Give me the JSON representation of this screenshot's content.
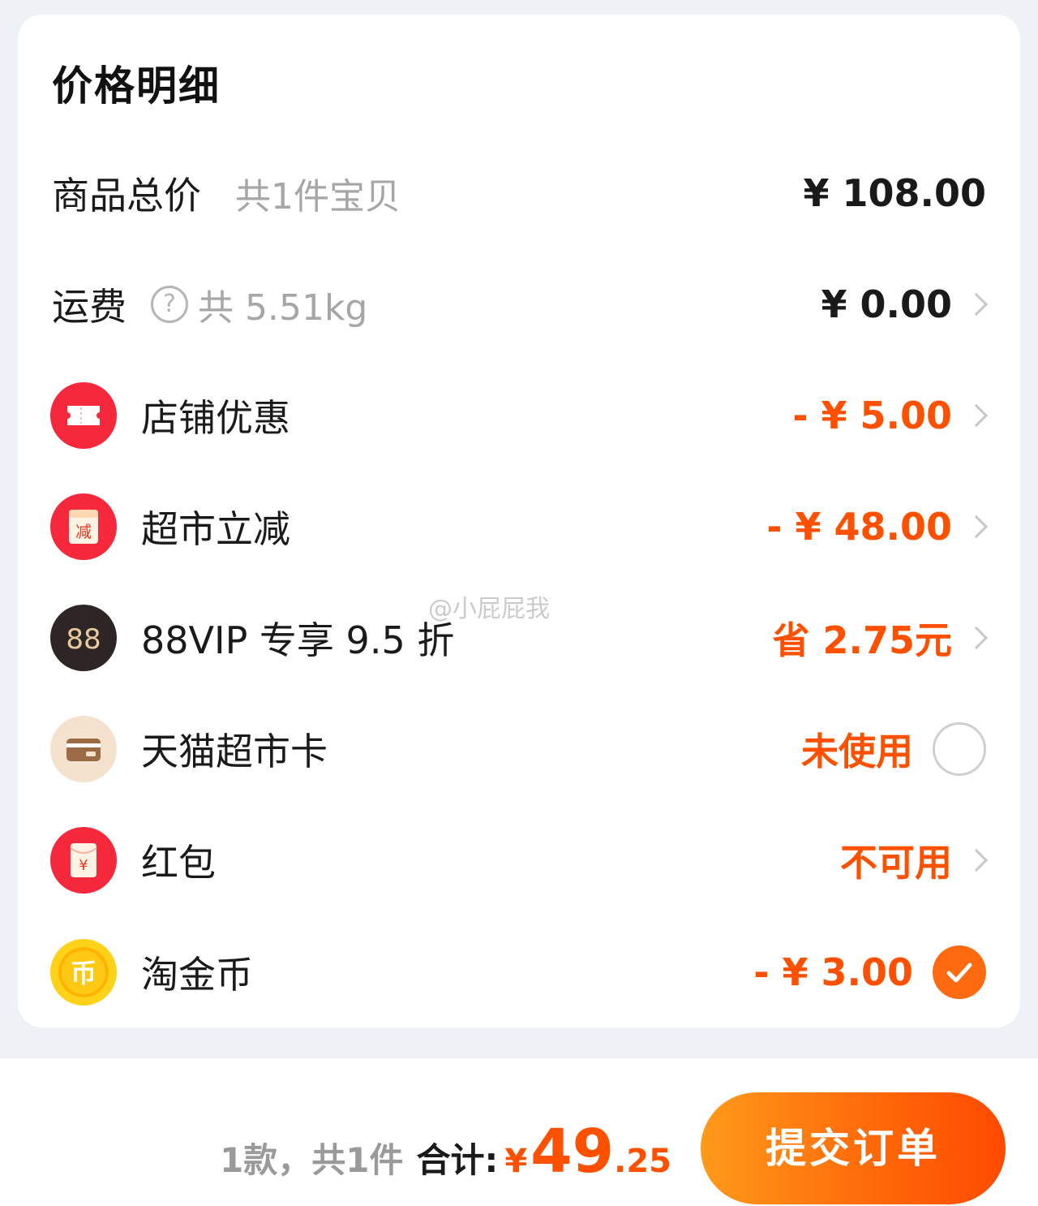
{
  "card": {
    "title": "价格明细"
  },
  "rows": {
    "goods_total": {
      "label": "商品总价",
      "sub": "共1件宝贝",
      "value": "¥ 108.00"
    },
    "shipping": {
      "label": "运费",
      "help_glyph": "?",
      "sub": "共 5.51kg",
      "value": "¥ 0.00"
    },
    "store_discount": {
      "label": "店铺优惠",
      "value": "- ¥ 5.00",
      "icon": "ticket-icon"
    },
    "supermarket_off": {
      "label": "超市立减",
      "value": "- ¥ 48.00",
      "icon": "reduce-icon",
      "icon_text": "减"
    },
    "vip88": {
      "label": "88VIP 专享 9.5 折",
      "value": "省 2.75元",
      "icon": "vip88-icon",
      "icon_text": "88"
    },
    "tmall_card": {
      "label": "天猫超市卡",
      "value": "未使用",
      "icon": "card-icon"
    },
    "red_packet": {
      "label": "红包",
      "value": "不可用",
      "icon": "red-packet-icon",
      "icon_text": "¥"
    },
    "taojin_coin": {
      "label": "淘金币",
      "value": "- ¥ 3.00",
      "icon": "coin-icon",
      "icon_text": "币"
    }
  },
  "watermark": "@小屁屁我",
  "bottom": {
    "count_text": "1款，共1件",
    "total_label": "合计:",
    "currency": "¥",
    "total_int": "49",
    "total_dec": ".25",
    "submit_label": "提交订单"
  },
  "colors": {
    "accent": "#ff5000",
    "button_start": "#ff9a1a",
    "button_end": "#ff4a00",
    "background": "#eef1f5"
  }
}
